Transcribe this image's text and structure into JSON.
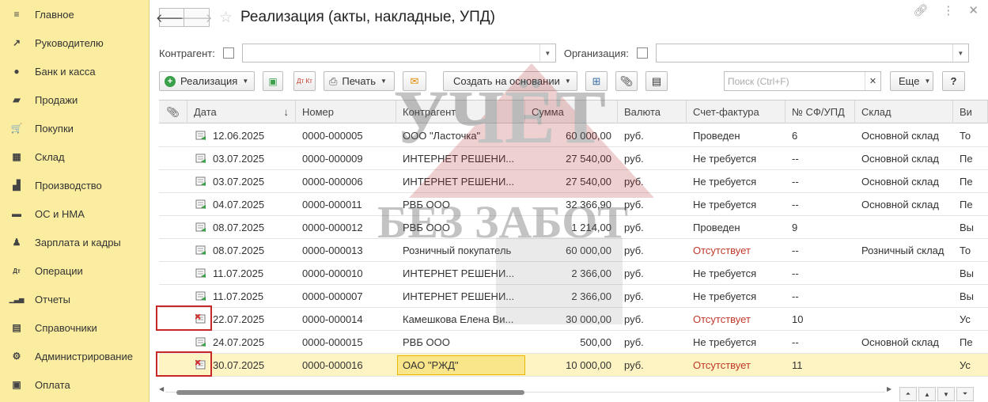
{
  "sidebar": {
    "items": [
      {
        "label": "Главное",
        "icon": "menu-icon",
        "glyph": "≡"
      },
      {
        "label": "Руководителю",
        "icon": "trend-icon",
        "glyph": "↗"
      },
      {
        "label": "Банк и касса",
        "icon": "coin-icon",
        "glyph": "●"
      },
      {
        "label": "Продажи",
        "icon": "bag-icon",
        "glyph": "▰"
      },
      {
        "label": "Покупки",
        "icon": "cart-icon",
        "glyph": "🛒"
      },
      {
        "label": "Склад",
        "icon": "warehouse-icon",
        "glyph": "▦"
      },
      {
        "label": "Производство",
        "icon": "factory-icon",
        "glyph": "▟"
      },
      {
        "label": "ОС и НМА",
        "icon": "truck-icon",
        "glyph": "▬"
      },
      {
        "label": "Зарплата и кадры",
        "icon": "person-icon",
        "glyph": "♟"
      },
      {
        "label": "Операции",
        "icon": "dt-kt-icon",
        "glyph": "Дт"
      },
      {
        "label": "Отчеты",
        "icon": "bar-chart-icon",
        "glyph": "▁▃▅"
      },
      {
        "label": "Справочники",
        "icon": "book-icon",
        "glyph": "▤"
      },
      {
        "label": "Администрирование",
        "icon": "gear-icon",
        "glyph": "⚙"
      },
      {
        "label": "Оплата",
        "icon": "payment-icon",
        "glyph": "▣"
      }
    ]
  },
  "header": {
    "title": "Реализация (акты, накладные, УПД)"
  },
  "filters": {
    "counterparty_label": "Контрагент:",
    "counterparty_value": "",
    "organization_label": "Организация:",
    "organization_value": ""
  },
  "toolbar": {
    "realization_label": "Реализация",
    "print_label": "Печать",
    "dt_kt": "Дт Кт",
    "create_basis_label": "Создать на основании",
    "search_placeholder": "Поиск (Ctrl+F)",
    "more_label": "Еще",
    "help_label": "?"
  },
  "table": {
    "headers": [
      "Дата",
      "Номер",
      "Контрагент",
      "Сумма",
      "Валюта",
      "Счет-фактура",
      "№ СФ/УПД",
      "Склад",
      "Ви"
    ],
    "rows": [
      {
        "status": "posted",
        "date": "12.06.2025",
        "number": "0000-000005",
        "counterparty": "ООО \"Ласточка\"",
        "sum": "60 000,00",
        "currency": "руб.",
        "invoice": "Проведен",
        "invoice_no": "6",
        "warehouse": "Основной склад",
        "type": "То"
      },
      {
        "status": "posted",
        "date": "03.07.2025",
        "number": "0000-000009",
        "counterparty": "ИНТЕРНЕТ РЕШЕНИ...",
        "sum": "27 540,00",
        "currency": "руб.",
        "invoice": "Не требуется",
        "invoice_no": "--",
        "warehouse": "Основной склад",
        "type": "Пе"
      },
      {
        "status": "posted",
        "date": "03.07.2025",
        "number": "0000-000006",
        "counterparty": "ИНТЕРНЕТ РЕШЕНИ...",
        "sum": "27 540,00",
        "currency": "руб.",
        "invoice": "Не требуется",
        "invoice_no": "--",
        "warehouse": "Основной склад",
        "type": "Пе"
      },
      {
        "status": "posted",
        "date": "04.07.2025",
        "number": "0000-000011",
        "counterparty": "РВБ ООО",
        "sum": "32 366,90",
        "currency": "руб.",
        "invoice": "Не требуется",
        "invoice_no": "--",
        "warehouse": "Основной склад",
        "type": "Пе"
      },
      {
        "status": "posted",
        "date": "08.07.2025",
        "number": "0000-000012",
        "counterparty": "РВБ ООО",
        "sum": "1 214,00",
        "currency": "руб.",
        "invoice": "Проведен",
        "invoice_no": "9",
        "warehouse": "",
        "type": "Вы"
      },
      {
        "status": "posted",
        "date": "08.07.2025",
        "number": "0000-000013",
        "counterparty": "Розничный покупатель",
        "sum": "60 000,00",
        "currency": "руб.",
        "invoice": "Отсутствует",
        "invoice_red": true,
        "invoice_no": "--",
        "warehouse": "Розничный склад",
        "type": "То"
      },
      {
        "status": "posted",
        "date": "11.07.2025",
        "number": "0000-000010",
        "counterparty": "ИНТЕРНЕТ РЕШЕНИ...",
        "sum": "2 366,00",
        "currency": "руб.",
        "invoice": "Не требуется",
        "invoice_no": "--",
        "warehouse": "",
        "type": "Вы"
      },
      {
        "status": "posted",
        "date": "11.07.2025",
        "number": "0000-000007",
        "counterparty": "ИНТЕРНЕТ РЕШЕНИ...",
        "sum": "2 366,00",
        "currency": "руб.",
        "invoice": "Не требуется",
        "invoice_no": "--",
        "warehouse": "",
        "type": "Вы"
      },
      {
        "status": "deleted",
        "date": "22.07.2025",
        "number": "0000-000014",
        "counterparty": "Камешкова Елена Ви...",
        "sum": "30 000,00",
        "currency": "руб.",
        "invoice": "Отсутствует",
        "invoice_red": true,
        "invoice_no": "10",
        "warehouse": "",
        "type": "Ус"
      },
      {
        "status": "posted",
        "date": "24.07.2025",
        "number": "0000-000015",
        "counterparty": "РВБ ООО",
        "sum": "500,00",
        "currency": "руб.",
        "invoice": "Не требуется",
        "invoice_no": "--",
        "warehouse": "Основной склад",
        "type": "Пе"
      },
      {
        "status": "deleted",
        "date": "30.07.2025",
        "number": "0000-000016",
        "counterparty": "ОАО \"РЖД\"",
        "sum": "10 000,00",
        "currency": "руб.",
        "invoice": "Отсутствует",
        "invoice_red": true,
        "invoice_no": "11",
        "warehouse": "",
        "type": "Ус",
        "selected": true
      }
    ]
  },
  "watermark": {
    "line1": "УЧЁТ",
    "line2": "БЕЗ ЗАБОТ"
  },
  "colors": {
    "sidebar_bg": "#fbeda0",
    "selected_row": "#fdf3c3",
    "red_text": "#c0392b",
    "posted_icon": "#3aa04a",
    "deleted_icon": "#d32f2f"
  }
}
